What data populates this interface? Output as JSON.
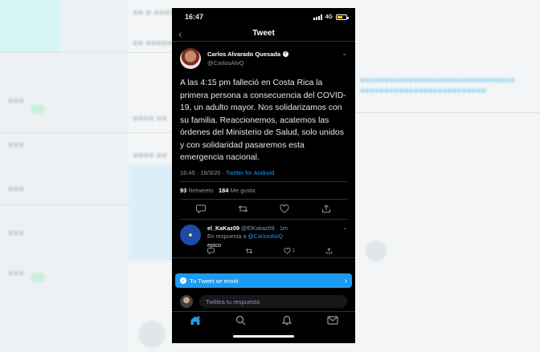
{
  "status": {
    "time": "16:47",
    "network": "4G"
  },
  "nav": {
    "title": "Tweet"
  },
  "tweet": {
    "author_name": "Carlos Alvarado Quesada",
    "author_handle": "@CarlosAlvQ",
    "text": "A las 4:15 pm falleció en Costa Rica la primera persona a consecuencia del COVID-19, un adulto mayor. Nos solidarizamos con su familia. Reaccionemos, acatemos las órdenes del Ministerio de Salud, solo unidos y con solidaridad pasaremos esta emergencia nacional.",
    "timestamp": "16:45 · 18/3/20 ·",
    "source": "Twitter for Android",
    "retweets_count": "93",
    "retweets_label": "Retweets",
    "likes_count": "184",
    "likes_label": "Me gusta"
  },
  "reply": {
    "name": "el_KaKaz09",
    "handle_time": "@ElKakaz09 · 1m",
    "replying_prefix": "En respuesta a",
    "replying_mention": "@CarlosAlvQ",
    "text": "epico",
    "like_count": "1"
  },
  "toast": {
    "text": "Tu Tweet se envió"
  },
  "composer": {
    "placeholder": "Twittea tu respuesta"
  },
  "colors": {
    "accent": "#1d9bf0",
    "background": "#000000",
    "muted": "#8b98a5"
  },
  "icons": {
    "tabs": [
      "home-icon",
      "search-icon",
      "notifications-icon",
      "messages-icon"
    ],
    "tweet_actions": [
      "reply-icon",
      "retweet-icon",
      "like-icon",
      "share-icon"
    ]
  }
}
